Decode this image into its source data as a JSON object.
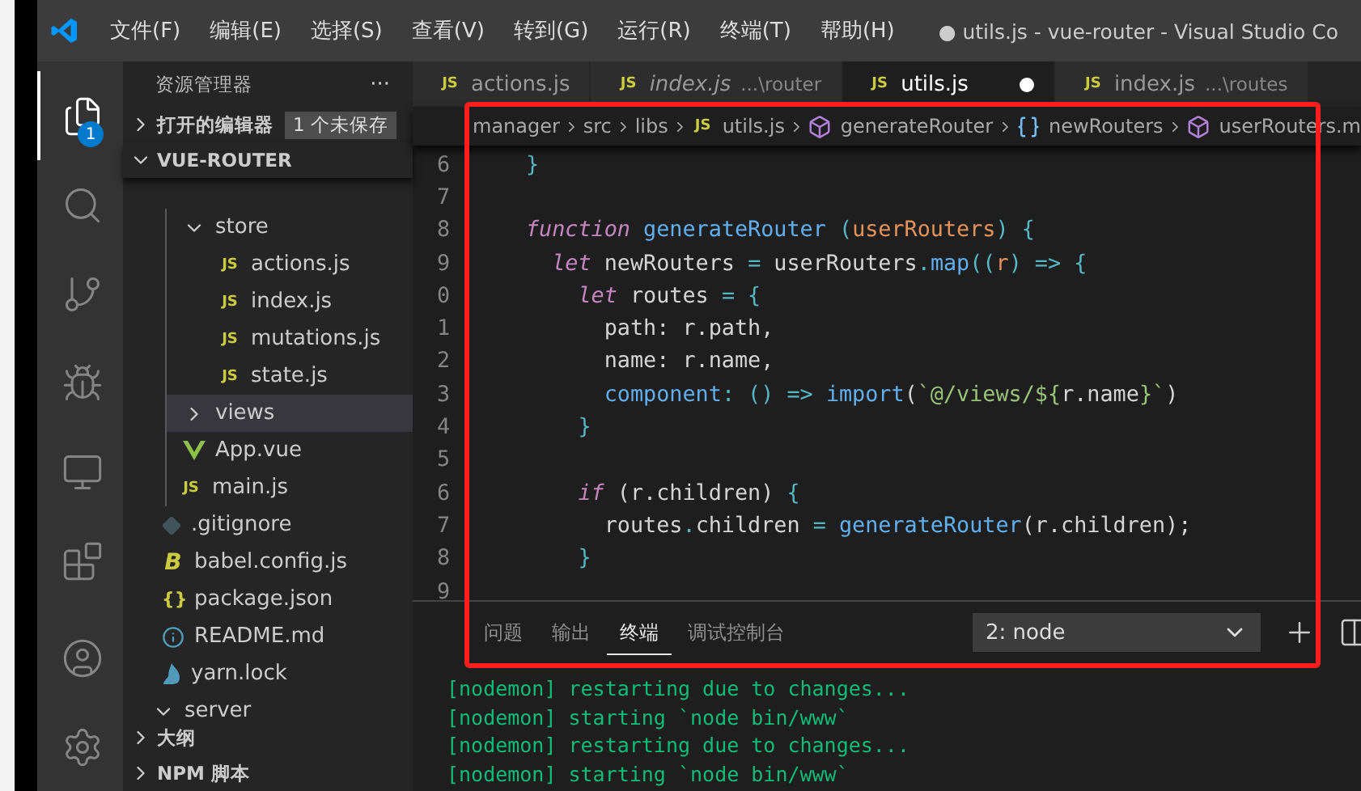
{
  "title_bar": {
    "menus": [
      "文件(F)",
      "编辑(E)",
      "选择(S)",
      "查看(V)",
      "转到(G)",
      "运行(R)",
      "终端(T)",
      "帮助(H)"
    ],
    "title": "● utils.js - vue-router - Visual Studio Co"
  },
  "activity_bar": {
    "items": [
      {
        "kind": "explorer",
        "selected": true,
        "badge": "1"
      },
      {
        "kind": "search",
        "selected": false
      },
      {
        "kind": "source-control",
        "selected": false
      },
      {
        "kind": "debug",
        "selected": false
      },
      {
        "kind": "remote",
        "selected": false
      },
      {
        "kind": "extensions",
        "selected": false
      },
      {
        "kind": "account",
        "selected": false
      },
      {
        "kind": "settings",
        "selected": false
      }
    ]
  },
  "sidebar": {
    "header": "资源管理器",
    "more": "···",
    "open_editors": {
      "label": "打开的编辑器",
      "badge": "1 个未保存",
      "expanded": false
    },
    "project": {
      "label": "VUE-ROUTER",
      "expanded": true
    },
    "nested_items": [
      {
        "label": "store",
        "kind": "folder",
        "expanded": true,
        "selected": false,
        "children": [
          {
            "label": "actions.js",
            "kind": "js",
            "icon_text": "JS",
            "selected": false
          },
          {
            "label": "index.js",
            "kind": "js",
            "icon_text": "JS",
            "selected": false
          },
          {
            "label": "mutations.js",
            "kind": "js",
            "icon_text": "JS",
            "selected": false
          },
          {
            "label": "state.js",
            "kind": "js",
            "icon_text": "JS",
            "selected": false
          }
        ]
      },
      {
        "label": "views",
        "kind": "folder",
        "expanded": false,
        "selected": true
      },
      {
        "label": "App.vue",
        "kind": "vue",
        "selected": false
      },
      {
        "label": "main.js",
        "kind": "js",
        "icon_text": "JS",
        "selected": false
      }
    ],
    "items": [
      {
        "label": ".gitignore",
        "kind": "git",
        "selected": false
      },
      {
        "label": "babel.config.js",
        "kind": "babel",
        "icon_text": "B",
        "selected": false
      },
      {
        "label": "package.json",
        "kind": "json",
        "icon_text": "{}",
        "selected": false
      },
      {
        "label": "README.md",
        "kind": "info",
        "selected": false
      },
      {
        "label": "yarn.lock",
        "kind": "yarn",
        "selected": false
      },
      {
        "label": "server",
        "kind": "folder",
        "expanded": true,
        "selected": false
      }
    ],
    "sections": [
      {
        "label": "大纲",
        "expanded": false
      },
      {
        "label": "NPM 脚本",
        "expanded": false
      }
    ]
  },
  "editor": {
    "tabs": [
      {
        "label": "actions.js",
        "icon_text": "JS",
        "selected": false,
        "preview": false
      },
      {
        "label": "index.js",
        "description": "...\\router",
        "icon_text": "JS",
        "selected": false,
        "preview": true
      },
      {
        "label": "utils.js",
        "icon_text": "JS",
        "selected": true,
        "preview": false,
        "dirty": true
      },
      {
        "label": "index.js",
        "description": "...\\routes",
        "icon_text": "JS",
        "selected": false,
        "preview": false
      }
    ],
    "breadcrumb": [
      {
        "label": "manager",
        "kind": "folder"
      },
      {
        "label": "src",
        "kind": "folder"
      },
      {
        "label": "libs",
        "kind": "folder"
      },
      {
        "label": "utils.js",
        "kind": "file",
        "icon_text": "JS"
      },
      {
        "label": "generateRouter",
        "kind": "method"
      },
      {
        "label": "newRouters",
        "kind": "variable"
      },
      {
        "label": "userRouters.m",
        "kind": "method"
      }
    ],
    "lines": [
      {
        "number": "6",
        "tokens": [
          {
            "text": "}",
            "kind": "brace"
          }
        ]
      },
      {
        "number": "7"
      },
      {
        "number": "8",
        "tokens": [
          {
            "text": "function",
            "kind": "kw"
          },
          {
            "text": " generateRouter",
            "kind": "fn"
          },
          {
            "text": " (",
            "kind": "op"
          },
          {
            "text": "userRouters",
            "kind": "param"
          },
          {
            "text": ") {",
            "kind": "op"
          }
        ]
      },
      {
        "number": "9",
        "tokens": [
          {
            "text": "  let",
            "kind": "kw"
          },
          {
            "text": " newRouters ",
            "kind": "plain"
          },
          {
            "text": "=",
            "kind": "op"
          },
          {
            "text": " userRouters",
            "kind": "plain"
          },
          {
            "text": ".",
            "kind": "op"
          },
          {
            "text": "map",
            "kind": "fn"
          },
          {
            "text": "((",
            "kind": "op"
          },
          {
            "text": "r",
            "kind": "param"
          },
          {
            "text": ") => {",
            "kind": "op"
          }
        ]
      },
      {
        "number": "0",
        "tokens": [
          {
            "text": "    let",
            "kind": "kw"
          },
          {
            "text": " routes ",
            "kind": "plain"
          },
          {
            "text": "= {",
            "kind": "op"
          }
        ]
      },
      {
        "number": "1",
        "tokens": [
          {
            "text": "      path: r.path,",
            "kind": "plain"
          }
        ]
      },
      {
        "number": "2",
        "tokens": [
          {
            "text": "      name: r.name,",
            "kind": "plain"
          }
        ]
      },
      {
        "number": "3",
        "tokens": [
          {
            "text": "      component",
            "kind": "fn"
          },
          {
            "text": ": () => ",
            "kind": "op"
          },
          {
            "text": "import",
            "kind": "fn"
          },
          {
            "text": "(",
            "kind": "plain"
          },
          {
            "text": "`@/views/${",
            "kind": "str"
          },
          {
            "text": "r.name",
            "kind": "plain"
          },
          {
            "text": "}`",
            "kind": "str"
          },
          {
            "text": ")",
            "kind": "plain"
          }
        ]
      },
      {
        "number": "4",
        "tokens": [
          {
            "text": "    }",
            "kind": "brace"
          }
        ]
      },
      {
        "number": "5"
      },
      {
        "number": "6",
        "tokens": [
          {
            "text": "    if",
            "kind": "kw"
          },
          {
            "text": " (r.children) ",
            "kind": "plain"
          },
          {
            "text": "{",
            "kind": "brace"
          }
        ]
      },
      {
        "number": "7",
        "tokens": [
          {
            "text": "      routes",
            "kind": "plain"
          },
          {
            "text": ".",
            "kind": "op"
          },
          {
            "text": "children ",
            "kind": "plain"
          },
          {
            "text": "=",
            "kind": "op"
          },
          {
            "text": " generateRouter",
            "kind": "fn"
          },
          {
            "text": "(r.children);",
            "kind": "plain"
          }
        ]
      },
      {
        "number": "8",
        "tokens": [
          {
            "text": "    }",
            "kind": "brace"
          }
        ]
      },
      {
        "number": "9"
      }
    ]
  },
  "panel": {
    "tabs": [
      {
        "label": "问题",
        "selected": false
      },
      {
        "label": "输出",
        "selected": false
      },
      {
        "label": "终端",
        "selected": true
      },
      {
        "label": "调试控制台",
        "selected": false
      }
    ],
    "terminal_select": "2: node",
    "terminal_lines": [
      "[nodemon] restarting due to changes...",
      "[nodemon] starting `node bin/www`",
      "[nodemon] restarting due to changes...",
      "[nodemon] starting `node bin/www`"
    ]
  },
  "annotation": {
    "kind": "rectangle",
    "color": "#ff1e1e"
  }
}
